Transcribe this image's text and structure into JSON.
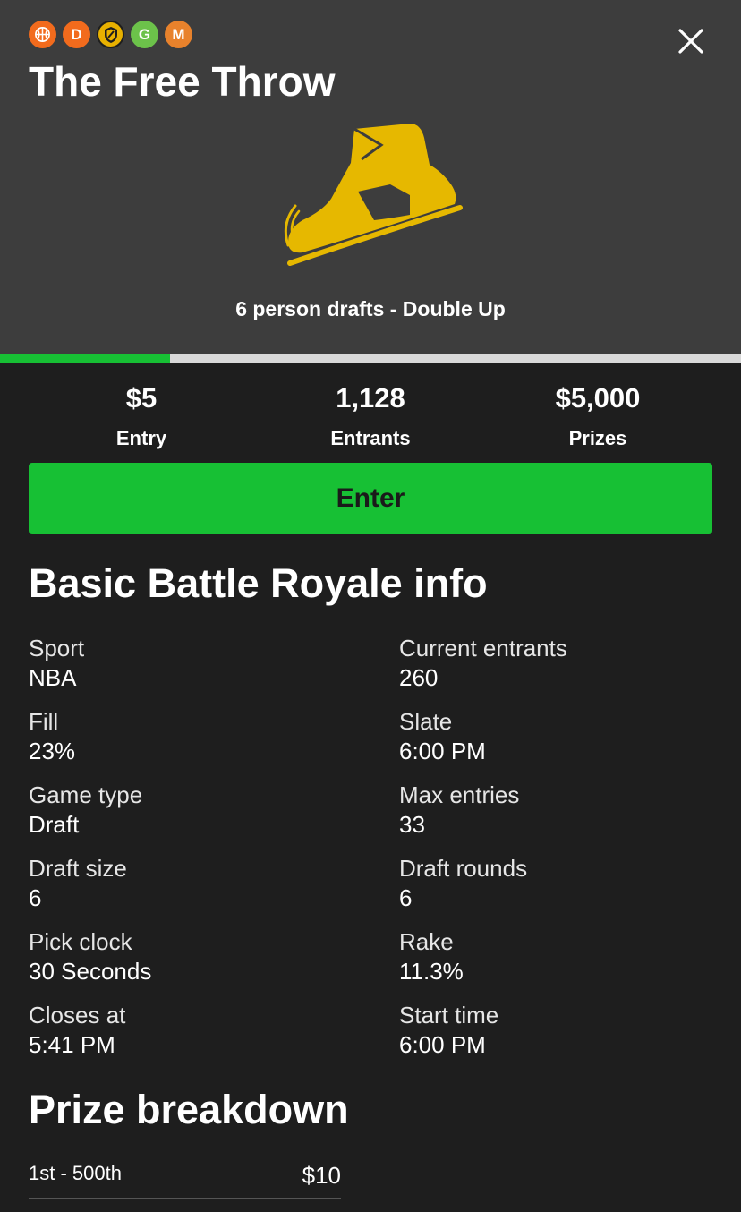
{
  "header": {
    "badges": [
      {
        "icon": "basketball-icon",
        "label": "",
        "color": "#f26b1d"
      },
      {
        "icon": "letter-d-icon",
        "label": "D",
        "color": "#f26b1d"
      },
      {
        "icon": "shield-icon",
        "label": "",
        "color": "#e8b100"
      },
      {
        "icon": "letter-g-icon",
        "label": "G",
        "color": "#6cc24a"
      },
      {
        "icon": "letter-m-icon",
        "label": "M",
        "color": "#e8822c"
      }
    ],
    "title": "The Free Throw",
    "illustration_icon": "sneaker-icon",
    "illustration_color": "#e6b800",
    "subtitle": "6 person drafts - Double Up",
    "close_icon": "close-icon"
  },
  "progress": {
    "fill_fraction": 0.23,
    "fill_color": "#17c034",
    "track_color": "#d9d9d9"
  },
  "stats": [
    {
      "value": "$5",
      "label": "Entry"
    },
    {
      "value": "1,128",
      "label": "Entrants"
    },
    {
      "value": "$5,000",
      "label": "Prizes"
    }
  ],
  "enter_button": {
    "label": "Enter",
    "color": "#17c034"
  },
  "info": {
    "title": "Basic Battle Royale info",
    "items": [
      {
        "label": "Sport",
        "value": "NBA"
      },
      {
        "label": "Current entrants",
        "value": "260"
      },
      {
        "label": "Fill",
        "value": "23%"
      },
      {
        "label": "Slate",
        "value": "6:00 PM"
      },
      {
        "label": "Game type",
        "value": "Draft"
      },
      {
        "label": "Max entries",
        "value": "33"
      },
      {
        "label": "Draft size",
        "value": "6"
      },
      {
        "label": "Draft rounds",
        "value": "6"
      },
      {
        "label": "Pick clock",
        "value": "30 Seconds"
      },
      {
        "label": "Rake",
        "value": "11.3%"
      },
      {
        "label": "Closes at",
        "value": "5:41 PM"
      },
      {
        "label": "Start time",
        "value": "6:00 PM"
      }
    ]
  },
  "prizes": {
    "title": "Prize breakdown",
    "rows": [
      {
        "place": "1st - 500th",
        "amount": "$10"
      }
    ]
  }
}
